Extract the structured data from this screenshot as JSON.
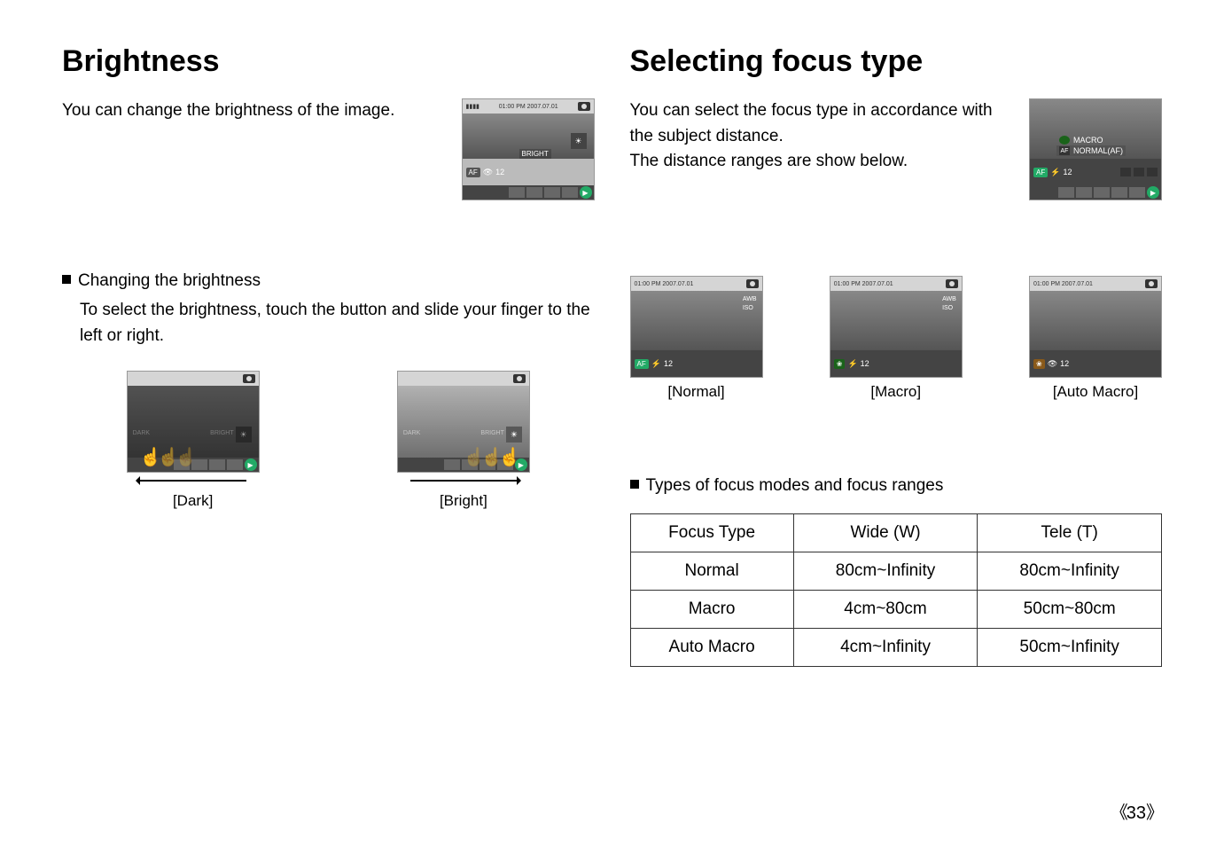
{
  "left": {
    "heading": "Brightness",
    "intro": "You can change the brightness of the image.",
    "sub_heading": "Changing the brightness",
    "sub_text": "To select the brightness, touch the button and slide your finger to the left or right.",
    "shot_labels": {
      "dark": "[Dark]",
      "bright": "[Bright]"
    },
    "slider_label": "BRIGHT",
    "slider_dark": "DARK",
    "slider_bright": "BRIGHT"
  },
  "right": {
    "heading": "Selecting focus type",
    "intro1": "You can select the focus type in accordance with the subject distance.",
    "intro2": "The distance ranges are show below.",
    "menu": {
      "macro": "MACRO",
      "normal": "NORMAL(AF)"
    },
    "shot_labels": {
      "normal": "[Normal]",
      "macro": "[Macro]",
      "auto": "[Auto Macro]"
    },
    "table_label": "Types of focus modes and focus ranges",
    "table": {
      "headers": [
        "Focus Type",
        "Wide (W)",
        "Tele (T)"
      ],
      "rows": [
        [
          "Normal",
          "80cm~Infinity",
          "80cm~Infinity"
        ],
        [
          "Macro",
          "4cm~80cm",
          "50cm~80cm"
        ],
        [
          "Auto Macro",
          "4cm~Infinity",
          "50cm~Infinity"
        ]
      ]
    }
  },
  "common": {
    "topbar_text": "01:00 PM 2007.07.01",
    "bottombar_count": "12",
    "af_label": "AF"
  },
  "page_number": "33"
}
